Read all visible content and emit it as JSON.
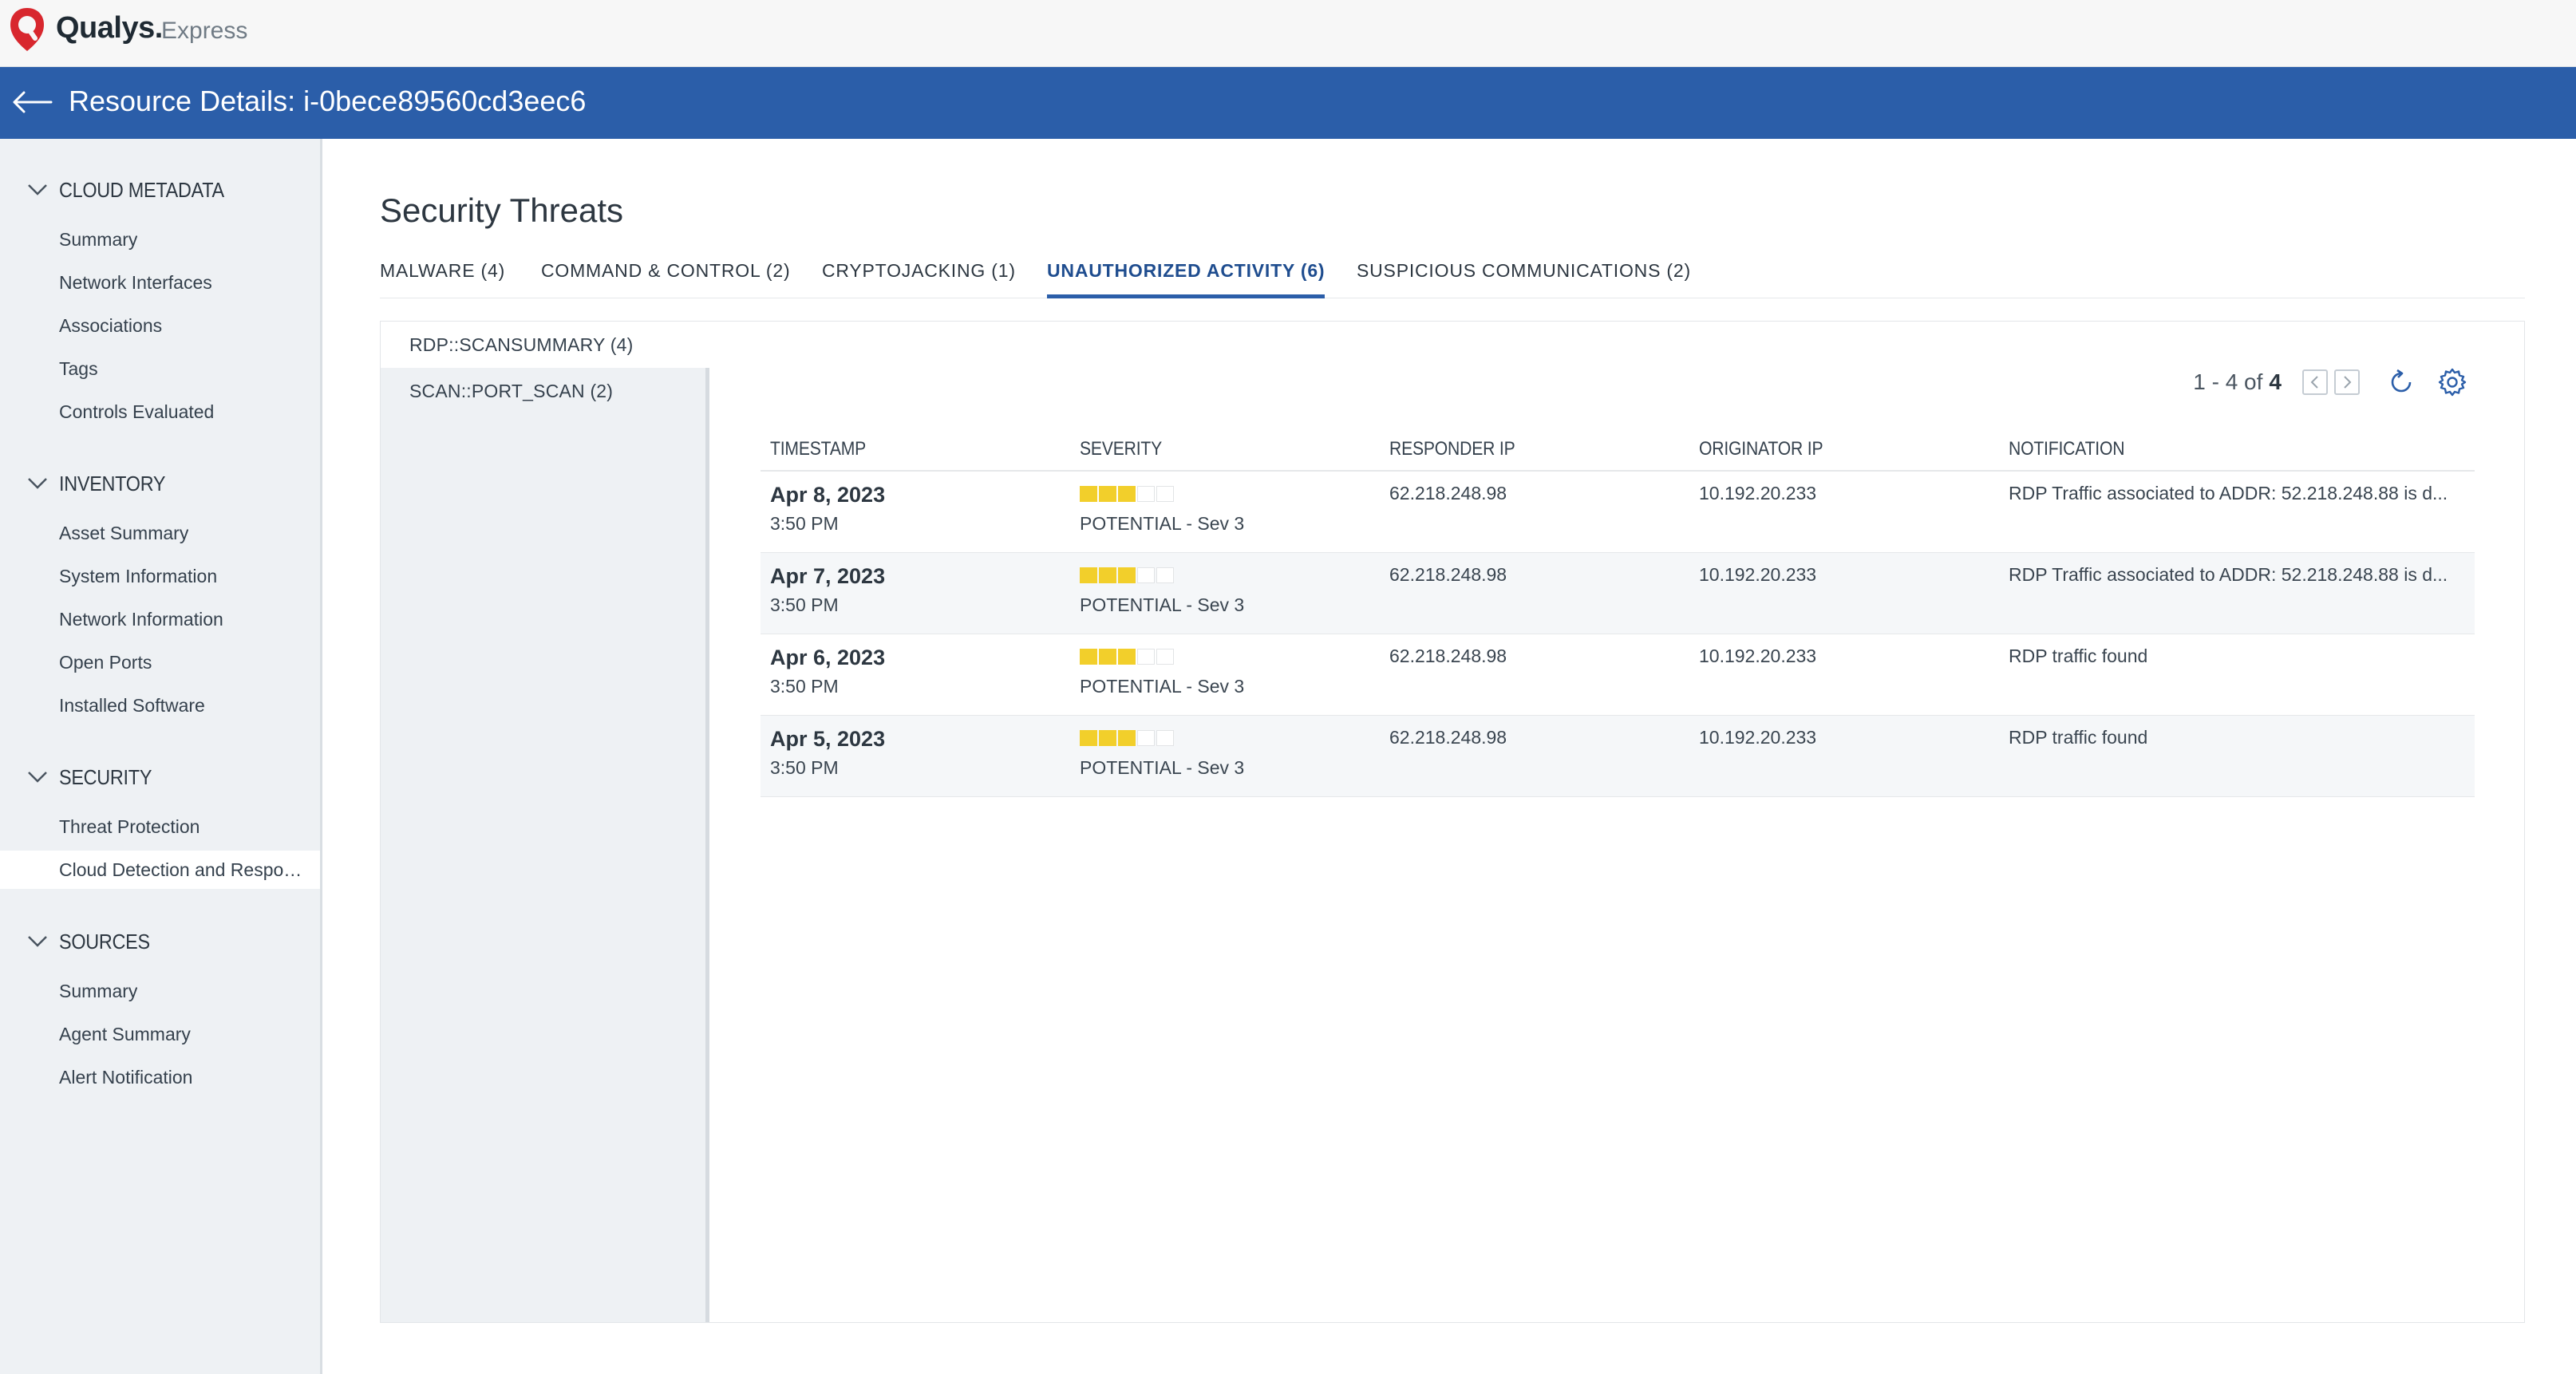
{
  "app": {
    "brand": "Qualys.",
    "edition": "Express"
  },
  "header": {
    "title": "Resource Details: i-0bece89560cd3eec6"
  },
  "sidebar": {
    "sections": [
      {
        "title": "CLOUD METADATA",
        "items": [
          "Summary",
          "Network Interfaces",
          "Associations",
          "Tags",
          "Controls Evaluated"
        ]
      },
      {
        "title": "INVENTORY",
        "items": [
          "Asset Summary",
          "System Information",
          "Network Information",
          "Open Ports",
          "Installed Software"
        ]
      },
      {
        "title": "SECURITY",
        "items": [
          "Threat Protection",
          "Cloud Detection and Response"
        ]
      },
      {
        "title": "SOURCES",
        "items": [
          "Summary",
          "Agent Summary",
          "Alert Notification"
        ]
      }
    ],
    "active_item": "Cloud Detection and Response"
  },
  "main": {
    "title": "Security Threats",
    "tabs": [
      {
        "label": "MALWARE (4)"
      },
      {
        "label": "COMMAND & CONTROL (2)"
      },
      {
        "label": "CRYPTOJACKING (1)"
      },
      {
        "label": "UNAUTHORIZED ACTIVITY (6)"
      },
      {
        "label": "SUSPICIOUS COMMUNICATIONS (2)"
      }
    ],
    "active_tab": "UNAUTHORIZED ACTIVITY (6)",
    "sub_categories": [
      {
        "label": "RDP::SCANSUMMARY (4)"
      },
      {
        "label": "SCAN::PORT_SCAN (2)"
      }
    ],
    "active_sub_category": "RDP::SCANSUMMARY (4)",
    "pager": {
      "range": "1 - 4 of",
      "total": "4"
    },
    "table": {
      "columns": [
        "TIMESTAMP",
        "SEVERITY",
        "RESPONDER IP",
        "ORIGINATOR IP",
        "NOTIFICATION"
      ],
      "rows": [
        {
          "date": "Apr 8, 2023",
          "time": "3:50 PM",
          "severity_level": 3,
          "severity_max": 5,
          "severity_label": "POTENTIAL - Sev 3",
          "responder_ip": "62.218.248.98",
          "originator_ip": "10.192.20.233",
          "notification": "RDP Traffic associated to ADDR: 52.218.248.88 is d..."
        },
        {
          "date": "Apr 7, 2023",
          "time": "3:50 PM",
          "severity_level": 3,
          "severity_max": 5,
          "severity_label": "POTENTIAL - Sev 3",
          "responder_ip": "62.218.248.98",
          "originator_ip": "10.192.20.233",
          "notification": "RDP Traffic associated to ADDR: 52.218.248.88 is d..."
        },
        {
          "date": "Apr 6, 2023",
          "time": "3:50 PM",
          "severity_level": 3,
          "severity_max": 5,
          "severity_label": "POTENTIAL - Sev 3",
          "responder_ip": "62.218.248.98",
          "originator_ip": "10.192.20.233",
          "notification": "RDP traffic found"
        },
        {
          "date": "Apr 5, 2023",
          "time": "3:50 PM",
          "severity_level": 3,
          "severity_max": 5,
          "severity_label": "POTENTIAL - Sev 3",
          "responder_ip": "62.218.248.98",
          "originator_ip": "10.192.20.233",
          "notification": "RDP traffic found"
        }
      ]
    }
  },
  "colors": {
    "header": "#2b5ea9",
    "accent": "#1f4d8f",
    "severity": "#f2cf2b",
    "logo": "#d8272e"
  }
}
